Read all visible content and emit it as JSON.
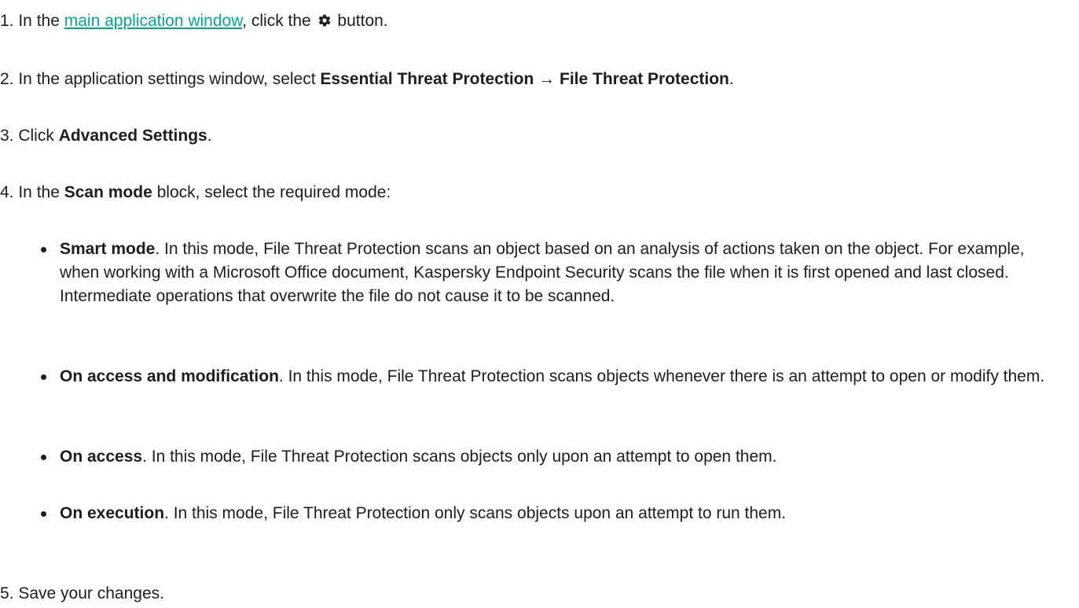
{
  "steps": {
    "s1": {
      "num": "1.",
      "pre": " In the ",
      "link": "main application window",
      "mid": ", click the ",
      "icon": "gear-icon",
      "post": " button."
    },
    "s2": {
      "num": "2.",
      "pre": " In the application settings window, select ",
      "bold1": "Essential Threat Protection",
      "arrow": " → ",
      "bold2": "File Threat Protection",
      "post": "."
    },
    "s3": {
      "num": "3.",
      "pre": " Click ",
      "bold": "Advanced Settings",
      "post": "."
    },
    "s4": {
      "num": "4.",
      "pre": " In the ",
      "bold": "Scan mode",
      "post": " block, select the required mode:"
    },
    "s5": {
      "num": "5.",
      "text": " Save your changes."
    }
  },
  "modes": [
    {
      "name": "Smart mode",
      "desc": ". In this mode, File Threat Protection scans an object based on an analysis of actions taken on the object. For example, when working with a Microsoft Office document, Kaspersky Endpoint Security scans the file when it is first opened and last closed. Intermediate operations that overwrite the file do not cause it to be scanned."
    },
    {
      "name": "On access and modification",
      "desc": ". In this mode, File Threat Protection scans objects whenever there is an attempt to open or modify them."
    },
    {
      "name": "On access",
      "desc": ". In this mode, File Threat Protection scans objects only upon an attempt to open them."
    },
    {
      "name": "On execution",
      "desc": ". In this mode, File Threat Protection only scans objects upon an attempt to run them."
    }
  ],
  "colors": {
    "link": "#00a88e",
    "text": "#1d1d1b"
  }
}
